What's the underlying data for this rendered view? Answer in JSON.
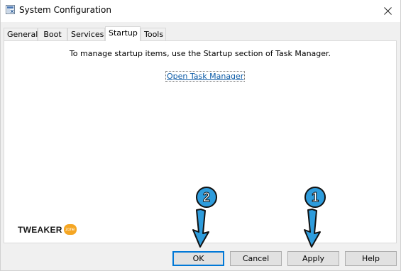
{
  "window": {
    "title": "System Configuration",
    "close_glyph": "✕"
  },
  "tabs": [
    {
      "label": "General"
    },
    {
      "label": "Boot"
    },
    {
      "label": "Services"
    },
    {
      "label": "Startup",
      "active": true
    },
    {
      "label": "Tools"
    }
  ],
  "startup_panel": {
    "message": "To manage startup items, use the Startup section of Task Manager.",
    "link_label": "Open Task Manager"
  },
  "brand": {
    "word": "TWEAKER",
    "badge": "zone"
  },
  "buttons": {
    "ok": "OK",
    "cancel": "Cancel",
    "apply": "Apply",
    "help": "Help"
  },
  "annotations": {
    "marker_1": "1",
    "marker_2": "2"
  },
  "colors": {
    "accent": "#0078d7",
    "link": "#0b5aa6",
    "marker_fill": "#2e9cdc",
    "brand_badge": "#f5a623"
  }
}
